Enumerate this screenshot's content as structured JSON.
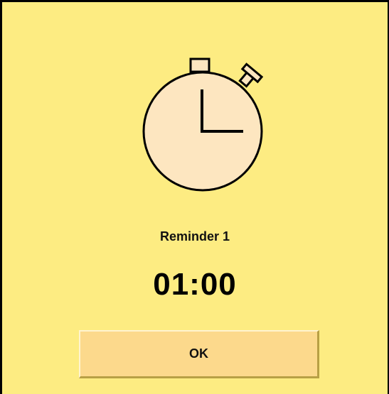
{
  "dialog": {
    "icon": "stopwatch-icon",
    "title": "Reminder 1",
    "timer": "01:00",
    "ok_label": "OK"
  },
  "colors": {
    "background": "#fdec82",
    "button": "#fcd98c",
    "clock_face": "#fde6c0"
  }
}
